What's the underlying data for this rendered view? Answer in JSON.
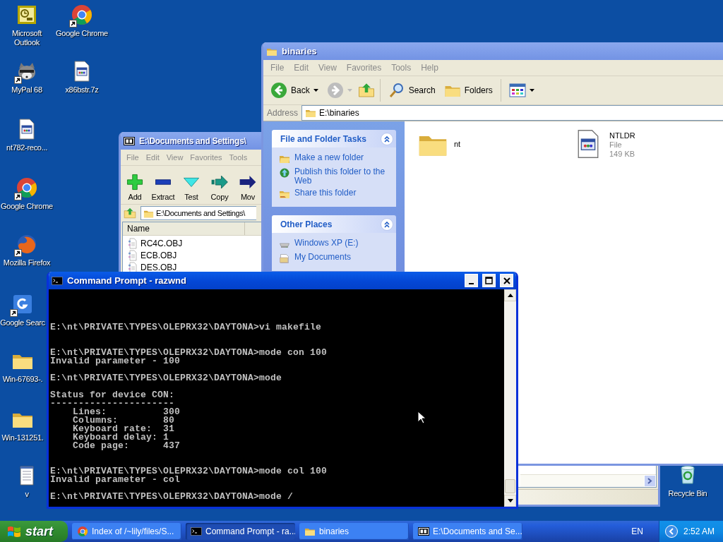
{
  "desktop_icons": [
    {
      "label": "Microsoft Outlook",
      "kind": "outlook",
      "shortcut": false
    },
    {
      "label": "Google Chrome",
      "kind": "chrome",
      "shortcut": true
    },
    {
      "label": "MyPal 68",
      "kind": "mypal",
      "shortcut": true
    },
    {
      "label": "x86bstr.7z",
      "kind": "file",
      "shortcut": false
    },
    {
      "label": "nt782-reco...",
      "kind": "file",
      "shortcut": false
    },
    {
      "label": "Google Chrome",
      "kind": "chrome",
      "shortcut": true
    },
    {
      "label": "Mozilla Firefox",
      "kind": "firefox",
      "shortcut": true
    },
    {
      "label": "Google Searc",
      "kind": "google",
      "shortcut": true
    },
    {
      "label": "Win-67693-.",
      "kind": "folder",
      "shortcut": false
    },
    {
      "label": "Win-131251.",
      "kind": "folder",
      "shortcut": false
    },
    {
      "label": "v",
      "kind": "notepad",
      "shortcut": false
    },
    {
      "label": "Recycle Bin",
      "kind": "recycle",
      "shortcut": false
    }
  ],
  "archive_window": {
    "title": "E:\\Documents and Settings\\",
    "active": false,
    "menu": [
      "File",
      "Edit",
      "View",
      "Favorites",
      "Tools"
    ],
    "toolbar": [
      {
        "label": "Add",
        "kind": "add"
      },
      {
        "label": "Extract",
        "kind": "extract"
      },
      {
        "label": "Test",
        "kind": "test"
      },
      {
        "label": "Copy",
        "kind": "copy"
      },
      {
        "label": "Mov",
        "kind": "move"
      }
    ],
    "address": "E:\\Documents and Settings\\",
    "columns": [
      "Name"
    ],
    "rows": [
      "RC4C.OBJ",
      "ECB.OBJ",
      "DES.OBJ"
    ]
  },
  "explorer_window": {
    "title": "binaries",
    "active": false,
    "menu": [
      "File",
      "Edit",
      "View",
      "Favorites",
      "Tools",
      "Help"
    ],
    "toolbar": {
      "back": "Back",
      "search": "Search",
      "folders": "Folders"
    },
    "address_label": "Address",
    "address": "E:\\binaries",
    "task_panels": [
      {
        "title": "File and Folder Tasks",
        "expanded": true,
        "items": [
          {
            "label": "Make a new folder",
            "kind": "new-folder"
          },
          {
            "label": "Publish this folder to the Web",
            "kind": "publish"
          },
          {
            "label": "Share this folder",
            "kind": "share"
          }
        ]
      },
      {
        "title": "Other Places",
        "expanded": true,
        "items": [
          {
            "label": "Windows XP (E:)",
            "kind": "drive"
          },
          {
            "label": "My Documents",
            "kind": "documents"
          }
        ]
      }
    ],
    "files": [
      {
        "name": "nt",
        "kind": "folder"
      },
      {
        "name": "NTLDR",
        "kind": "file",
        "type": "File",
        "size": "149 KB"
      }
    ]
  },
  "console_window": {
    "title": "Command Prompt - razwnd",
    "active": true,
    "output": "E:\\nt\\PRIVATE\\TYPES\\OLEPRX32\\DAYTONA>vi makefile\n\n\nE:\\nt\\PRIVATE\\TYPES\\OLEPRX32\\DAYTONA>mode con 100\nInvalid parameter - 100\n\nE:\\nt\\PRIVATE\\TYPES\\OLEPRX32\\DAYTONA>mode\n\nStatus for device CON:\n----------------------\n    Lines:          300\n    Columns:        80\n    Keyboard rate:  31\n    Keyboard delay: 1\n    Code page:      437\n\n\nE:\\nt\\PRIVATE\\TYPES\\OLEPRX32\\DAYTONA>mode col 100\nInvalid parameter - col\n\nE:\\nt\\PRIVATE\\TYPES\\OLEPRX32\\DAYTONA>mode /"
  },
  "taskbar": {
    "start": "start",
    "tasks": [
      {
        "label": "Index of /~lily/files/S...",
        "kind": "chrome",
        "selected": false
      },
      {
        "label": "Command Prompt - ra...",
        "kind": "console",
        "selected": true
      },
      {
        "label": "binaries",
        "kind": "folder",
        "selected": false
      },
      {
        "label": "E:\\Documents and Se...",
        "kind": "archive",
        "selected": false
      }
    ],
    "language": "EN",
    "clock": "2:52 AM"
  }
}
